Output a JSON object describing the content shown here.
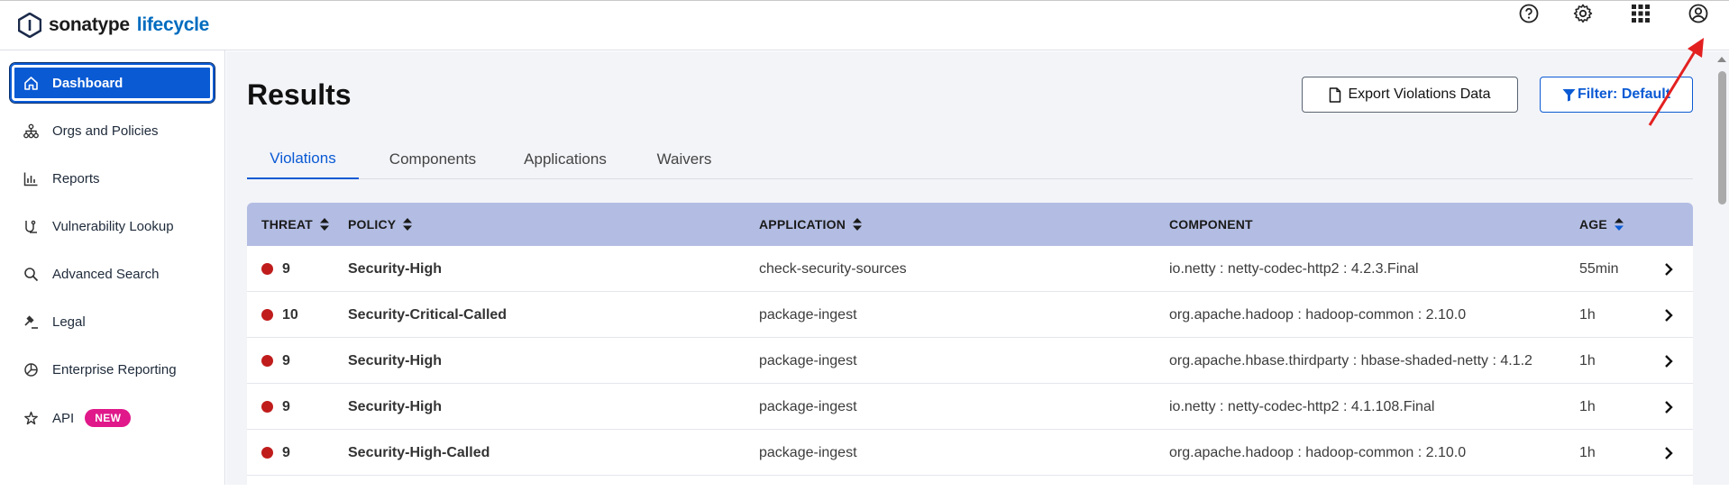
{
  "header": {
    "brand": "sonatype",
    "product": "lifecycle",
    "icons": [
      "help-icon",
      "settings-icon",
      "apps-grid-icon",
      "user-account-icon"
    ]
  },
  "sidebar": {
    "items": [
      {
        "label": "Dashboard",
        "icon": "home-icon",
        "active": true
      },
      {
        "label": "Orgs and Policies",
        "icon": "org-tree-icon"
      },
      {
        "label": "Reports",
        "icon": "bar-chart-icon"
      },
      {
        "label": "Vulnerability Lookup",
        "icon": "vulnerability-icon"
      },
      {
        "label": "Advanced Search",
        "icon": "search-icon"
      },
      {
        "label": "Legal",
        "icon": "gavel-icon"
      },
      {
        "label": "Enterprise Reporting",
        "icon": "pie-chart-icon"
      },
      {
        "label": "API",
        "icon": "api-icon",
        "badge": "NEW"
      }
    ]
  },
  "main": {
    "title": "Results",
    "export_button": "Export Violations Data",
    "filter_button": "Filter: Default",
    "tabs": [
      "Violations",
      "Components",
      "Applications",
      "Waivers"
    ],
    "active_tab": "Violations",
    "columns": [
      "THREAT",
      "POLICY",
      "APPLICATION",
      "COMPONENT",
      "AGE"
    ],
    "rows": [
      {
        "threat": "9",
        "policy": "Security-High",
        "application": "check-security-sources",
        "component": "io.netty : netty-codec-http2 : 4.2.3.Final",
        "age": "55min"
      },
      {
        "threat": "10",
        "policy": "Security-Critical-Called",
        "application": "package-ingest",
        "component": "org.apache.hadoop : hadoop-common : 2.10.0",
        "age": "1h"
      },
      {
        "threat": "9",
        "policy": "Security-High",
        "application": "package-ingest",
        "component": "org.apache.hbase.thirdparty : hbase-shaded-netty : 4.1.2",
        "age": "1h"
      },
      {
        "threat": "9",
        "policy": "Security-High",
        "application": "package-ingest",
        "component": "io.netty : netty-codec-http2 : 4.1.108.Final",
        "age": "1h"
      },
      {
        "threat": "9",
        "policy": "Security-High-Called",
        "application": "package-ingest",
        "component": "org.apache.hadoop : hadoop-common : 2.10.0",
        "age": "1h"
      }
    ]
  },
  "colors": {
    "accent": "#0a5ad4",
    "threat_critical": "#c01c1c",
    "table_header": "#b3bde3",
    "badge_new": "#e0188a",
    "annotation_arrow": "#e32020"
  }
}
